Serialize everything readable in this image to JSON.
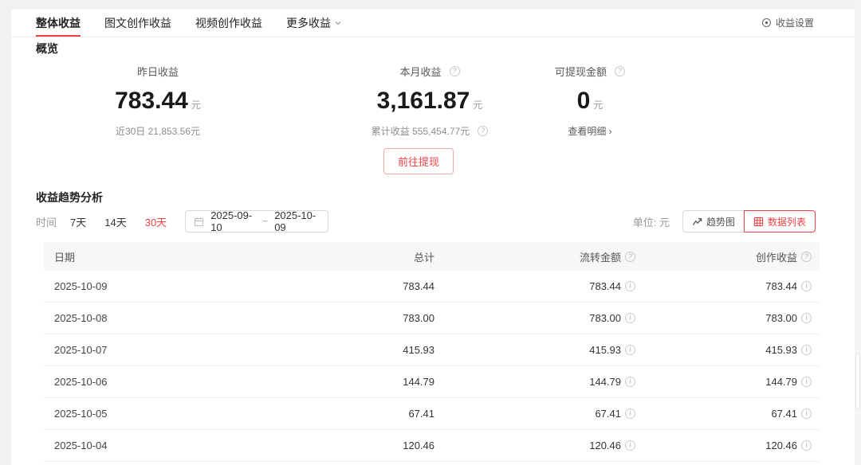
{
  "colors": {
    "accent": "#f04142",
    "border": "#ebebeb",
    "table_header_bg": "#f6f7f8"
  },
  "nav": {
    "tabs": [
      {
        "label": "整体收益"
      },
      {
        "label": "图文创作收益"
      },
      {
        "label": "视频创作收益"
      },
      {
        "label": "更多收益"
      }
    ],
    "settings_label": "收益设置"
  },
  "overview": {
    "title": "概览",
    "stats": [
      {
        "label": "昨日收益",
        "value": "783.44",
        "unit": "元",
        "sub": "近30日 21,853.56元"
      },
      {
        "label": "本月收益",
        "value": "3,161.87",
        "unit": "元",
        "sub": "累计收益 555,454.77元"
      },
      {
        "label": "可提现金额",
        "value": "0",
        "unit": "元",
        "link": "查看明细 ›"
      }
    ],
    "withdraw_label": "前往提现"
  },
  "trend": {
    "title": "收益趋势分析",
    "time_label": "时间",
    "ranges": [
      {
        "label": "7天"
      },
      {
        "label": "14天"
      },
      {
        "label": "30天"
      }
    ],
    "date_start": "2025-09-10",
    "date_separator": "~",
    "date_end": "2025-10-09",
    "unit_label": "单位: 元",
    "views": [
      {
        "label": "趋势图"
      },
      {
        "label": "数据列表"
      }
    ]
  },
  "table": {
    "columns": {
      "date": "日期",
      "total": "总计",
      "flow": "流转金额",
      "create": "创作收益"
    },
    "rows": [
      {
        "date": "2025-10-09",
        "total": "783.44",
        "flow": "783.44",
        "create": "783.44"
      },
      {
        "date": "2025-10-08",
        "total": "783.00",
        "flow": "783.00",
        "create": "783.00"
      },
      {
        "date": "2025-10-07",
        "total": "415.93",
        "flow": "415.93",
        "create": "415.93"
      },
      {
        "date": "2025-10-06",
        "total": "144.79",
        "flow": "144.79",
        "create": "144.79"
      },
      {
        "date": "2025-10-05",
        "total": "67.41",
        "flow": "67.41",
        "create": "67.41"
      },
      {
        "date": "2025-10-04",
        "total": "120.46",
        "flow": "120.46",
        "create": "120.46"
      }
    ]
  }
}
